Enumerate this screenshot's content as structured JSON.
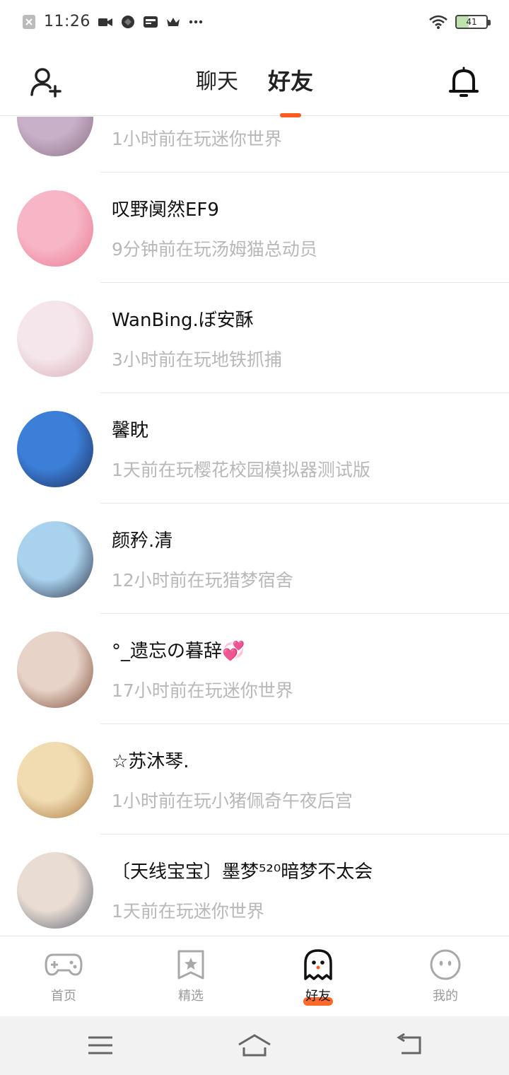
{
  "status_bar": {
    "time": "11:26",
    "battery": "41"
  },
  "header": {
    "tabs": [
      {
        "label": "聊天",
        "active": false
      },
      {
        "label": "好友",
        "active": true
      }
    ],
    "accent_color": "#ff5a1f"
  },
  "friends": [
    {
      "name": "",
      "status": "1小时前在玩迷你世界",
      "avatar_colors": [
        "#c8b0c8",
        "#8a6f85"
      ]
    },
    {
      "name": "叹野阒然EF9",
      "status": "9分钟前在玩汤姆猫总动员",
      "avatar_colors": [
        "#f7b6c6",
        "#e8788f"
      ]
    },
    {
      "name": "WanBing.ぼ安酥",
      "status": "3小时前在玩地铁抓捕",
      "avatar_colors": [
        "#f4e6ea",
        "#d9a9b7"
      ]
    },
    {
      "name": "馨眈",
      "status": "1天前在玩樱花校园模拟器测试版",
      "avatar_colors": [
        "#3c7fd8",
        "#1d2a55"
      ]
    },
    {
      "name": "颜矜.清",
      "status": "12小时前在玩猎梦宿舍",
      "avatar_colors": [
        "#a9d2ee",
        "#2a2f45"
      ]
    },
    {
      "name": "°_遗忘の暮辞💞",
      "status": "17小时前在玩迷你世界",
      "avatar_colors": [
        "#e8d3c8",
        "#7a4a35"
      ]
    },
    {
      "name": "☆苏沐琴.",
      "status": "1小时前在玩小猪佩奇午夜后宫",
      "avatar_colors": [
        "#f1dcb2",
        "#a7743d"
      ]
    },
    {
      "name": "〔天线宝宝〕墨梦⁵²⁰暗梦不太会",
      "status": "1天前在玩迷你世界",
      "avatar_colors": [
        "#e9dcd2",
        "#596273"
      ]
    }
  ],
  "bottom_nav": [
    {
      "label": "首页",
      "icon": "gamepad-icon",
      "active": false
    },
    {
      "label": "精选",
      "icon": "star-badge-icon",
      "active": false
    },
    {
      "label": "好友",
      "icon": "ghost-icon",
      "active": true
    },
    {
      "label": "我的",
      "icon": "face-icon",
      "active": false
    }
  ]
}
